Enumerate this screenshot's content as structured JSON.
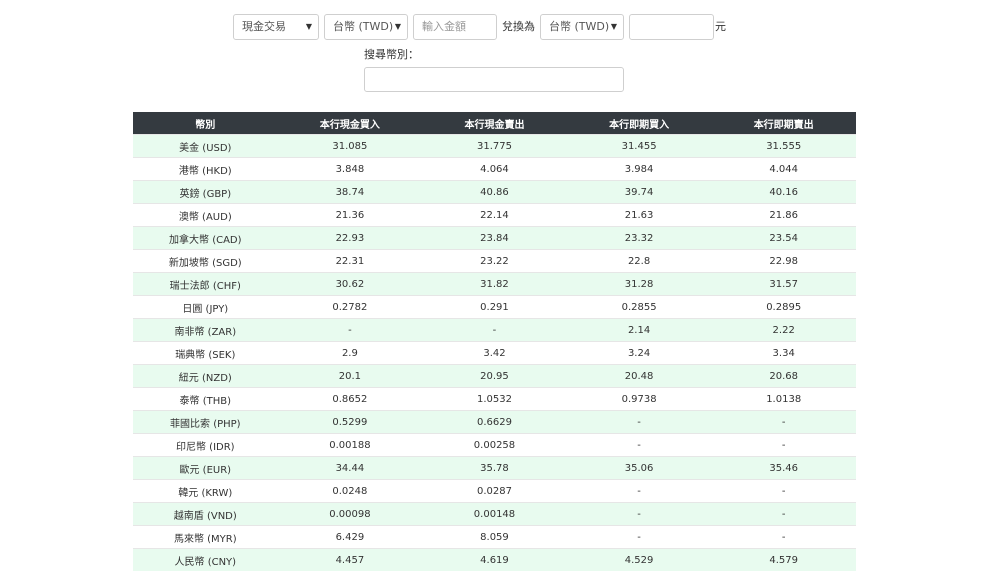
{
  "form": {
    "trade_type": "現金交易",
    "from_currency": "台幣 (TWD)",
    "amount_placeholder": "輸入金額",
    "convert_label": "兌換為",
    "to_currency": "台幣 (TWD)",
    "result_value": "",
    "unit_label": "元",
    "search_label": "搜尋幣別：",
    "search_value": ""
  },
  "table": {
    "headers": [
      "幣別",
      "本行現金買入",
      "本行現金賣出",
      "本行即期買入",
      "本行即期賣出"
    ],
    "rows": [
      [
        "美金 (USD)",
        "31.085",
        "31.775",
        "31.455",
        "31.555"
      ],
      [
        "港幣 (HKD)",
        "3.848",
        "4.064",
        "3.984",
        "4.044"
      ],
      [
        "英鎊 (GBP)",
        "38.74",
        "40.86",
        "39.74",
        "40.16"
      ],
      [
        "澳幣 (AUD)",
        "21.36",
        "22.14",
        "21.63",
        "21.86"
      ],
      [
        "加拿大幣 (CAD)",
        "22.93",
        "23.84",
        "23.32",
        "23.54"
      ],
      [
        "新加坡幣 (SGD)",
        "22.31",
        "23.22",
        "22.8",
        "22.98"
      ],
      [
        "瑞士法郎 (CHF)",
        "30.62",
        "31.82",
        "31.28",
        "31.57"
      ],
      [
        "日圓 (JPY)",
        "0.2782",
        "0.291",
        "0.2855",
        "0.2895"
      ],
      [
        "南非幣 (ZAR)",
        "-",
        "-",
        "2.14",
        "2.22"
      ],
      [
        "瑞典幣 (SEK)",
        "2.9",
        "3.42",
        "3.24",
        "3.34"
      ],
      [
        "紐元 (NZD)",
        "20.1",
        "20.95",
        "20.48",
        "20.68"
      ],
      [
        "泰幣 (THB)",
        "0.8652",
        "1.0532",
        "0.9738",
        "1.0138"
      ],
      [
        "菲國比索 (PHP)",
        "0.5299",
        "0.6629",
        "-",
        "-"
      ],
      [
        "印尼幣 (IDR)",
        "0.00188",
        "0.00258",
        "-",
        "-"
      ],
      [
        "歐元 (EUR)",
        "34.44",
        "35.78",
        "35.06",
        "35.46"
      ],
      [
        "韓元 (KRW)",
        "0.0248",
        "0.0287",
        "-",
        "-"
      ],
      [
        "越南盾 (VND)",
        "0.00098",
        "0.00148",
        "-",
        "-"
      ],
      [
        "馬來幣 (MYR)",
        "6.429",
        "8.059",
        "-",
        "-"
      ],
      [
        "人民幣 (CNY)",
        "4.457",
        "4.619",
        "4.529",
        "4.579"
      ]
    ]
  }
}
